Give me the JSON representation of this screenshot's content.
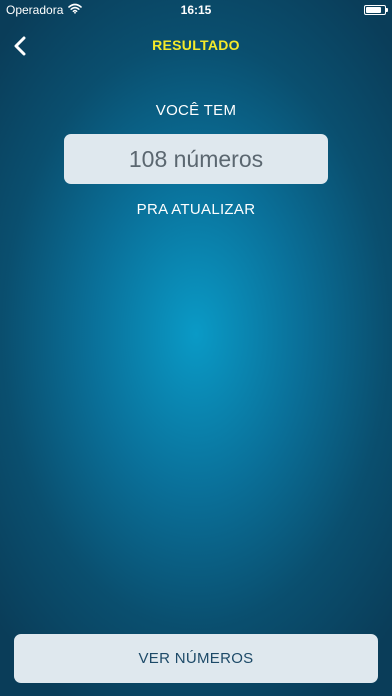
{
  "status_bar": {
    "carrier": "Operadora",
    "time": "16:15",
    "battery_level": 0.85
  },
  "nav": {
    "back_icon": "chevron-left-icon",
    "title": "RESULTADO"
  },
  "main": {
    "intro_label": "VOCÊ TEM",
    "count_text": "108 números",
    "sub_label": "PRA ATUALIZAR"
  },
  "actions": {
    "view_numbers_label": "VER NÚMEROS"
  },
  "colors": {
    "title_accent": "#f4ea2a",
    "background_center": "#0a9ac6",
    "background_edge": "#0a3d59",
    "panel": "#dfe8ee"
  }
}
